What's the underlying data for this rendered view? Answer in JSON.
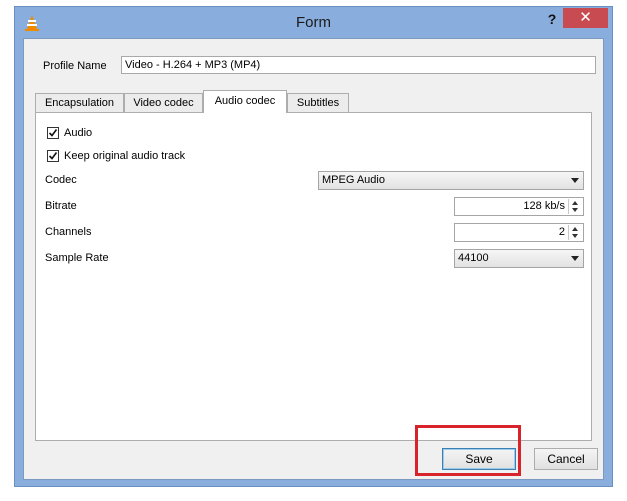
{
  "window": {
    "title": "Form",
    "help": "?",
    "close": "✕"
  },
  "profile": {
    "label": "Profile Name",
    "value": "Video - H.264 + MP3 (MP4)"
  },
  "tabs": [
    {
      "label": "Encapsulation"
    },
    {
      "label": "Video codec"
    },
    {
      "label": "Audio codec"
    },
    {
      "label": "Subtitles"
    }
  ],
  "audio": {
    "audio_label": "Audio",
    "keep_label": "Keep original audio track",
    "codec_label": "Codec",
    "codec_value": "MPEG Audio",
    "bitrate_label": "Bitrate",
    "bitrate_value": "128 kb/s",
    "channels_label": "Channels",
    "channels_value": "2",
    "samplerate_label": "Sample Rate",
    "samplerate_value": "44100"
  },
  "buttons": {
    "save": "Save",
    "cancel": "Cancel"
  },
  "colors": {
    "highlight": "#d8232a",
    "close": "#c74b50",
    "frame": "#89aedd"
  }
}
